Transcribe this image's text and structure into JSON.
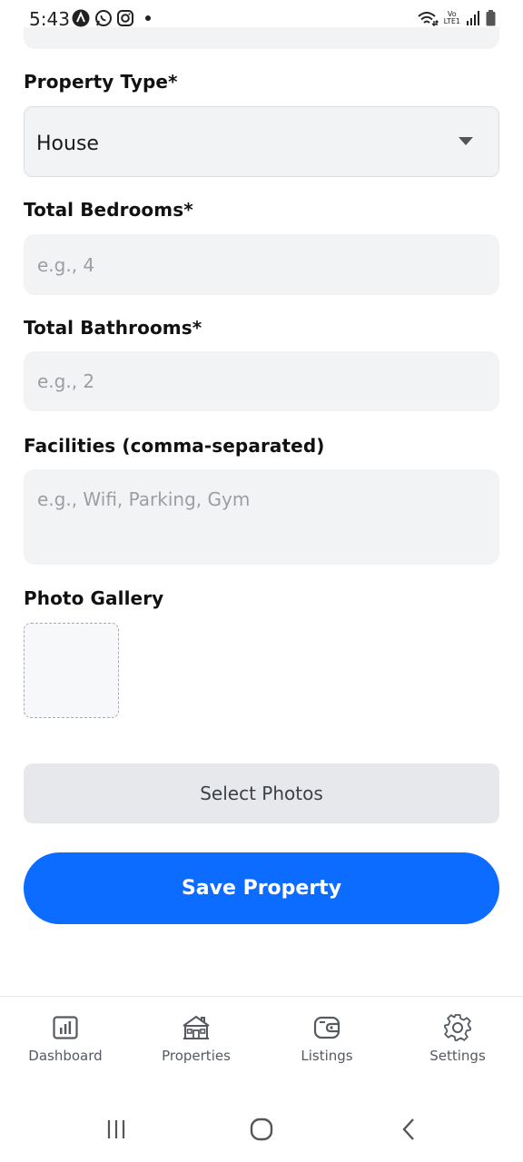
{
  "status_bar": {
    "time": "5:43",
    "left_icons": [
      "artifact-a-icon",
      "whatsapp-icon",
      "instagram-icon",
      "dot-icon"
    ],
    "right_icons": [
      "wifi-icon",
      "volte-icon",
      "signal-icon",
      "battery-icon"
    ],
    "volte_text_top": "Vo",
    "volte_text_bottom": "LTE1"
  },
  "form": {
    "property_type": {
      "label": "Property Type*",
      "value": "House"
    },
    "total_bedrooms": {
      "label": "Total Bedrooms*",
      "placeholder": "e.g., 4"
    },
    "total_bathrooms": {
      "label": "Total Bathrooms*",
      "placeholder": "e.g., 2"
    },
    "facilities": {
      "label": "Facilities (comma-separated)",
      "placeholder": "e.g., Wifi, Parking, Gym"
    },
    "photo_gallery": {
      "label": "Photo Gallery"
    },
    "select_photos_label": "Select Photos",
    "save_label": "Save Property"
  },
  "tabs": [
    {
      "label": "Dashboard",
      "icon": "bar-chart-icon"
    },
    {
      "label": "Properties",
      "icon": "house-icon"
    },
    {
      "label": "Listings",
      "icon": "wallet-icon"
    },
    {
      "label": "Settings",
      "icon": "gear-icon"
    }
  ],
  "colors": {
    "primary": "#0b6cff",
    "field_bg": "#f2f3f5",
    "secondary_button": "#e6e8eb"
  }
}
